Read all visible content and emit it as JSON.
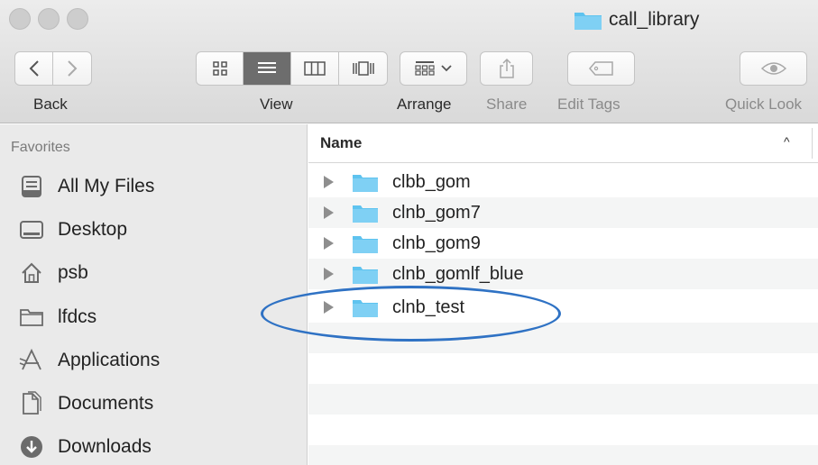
{
  "window": {
    "title": "call_library"
  },
  "toolbar": {
    "back_label": "Back",
    "view_label": "View",
    "arrange_label": "Arrange",
    "share_label": "Share",
    "edit_tags_label": "Edit Tags",
    "quick_look_label": "Quick Look"
  },
  "sidebar": {
    "header": "Favorites",
    "items": [
      {
        "label": "All My Files",
        "icon": "all-my-files-icon"
      },
      {
        "label": "Desktop",
        "icon": "desktop-icon"
      },
      {
        "label": "psb",
        "icon": "home-icon"
      },
      {
        "label": "lfdcs",
        "icon": "folder-icon"
      },
      {
        "label": "Applications",
        "icon": "applications-icon"
      },
      {
        "label": "Documents",
        "icon": "documents-icon"
      },
      {
        "label": "Downloads",
        "icon": "downloads-icon"
      }
    ]
  },
  "list": {
    "column_name": "Name",
    "sort_indicator": "^",
    "rows": [
      {
        "label": "clbb_gom"
      },
      {
        "label": "clnb_gom7"
      },
      {
        "label": "clnb_gom9"
      },
      {
        "label": "clnb_gomlf_blue"
      },
      {
        "label": "clnb_test"
      }
    ]
  },
  "colors": {
    "folder_blue": "#5ec3ef",
    "annotation_blue": "#2f72c4",
    "active_segment": "#6d6d6d"
  }
}
